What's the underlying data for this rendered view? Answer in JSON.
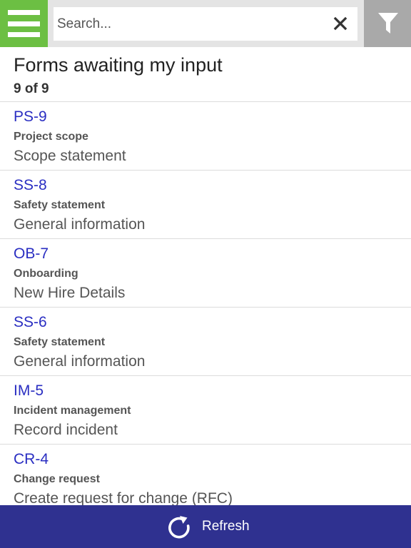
{
  "search": {
    "placeholder": "Search..."
  },
  "icons": {
    "menu": "hamburger-menu-icon",
    "clear": "close-icon",
    "filter": "filter-icon",
    "refresh": "refresh-icon"
  },
  "colors": {
    "menu_bg": "#6cbf43",
    "filter_bg": "#a9a9a9",
    "link": "#2a2ec2",
    "footer_bg": "#2f3190"
  },
  "header": {
    "title": "Forms awaiting my input",
    "count": "9 of 9"
  },
  "forms": [
    {
      "id": "PS-9",
      "category": "Project scope",
      "title": "Scope statement"
    },
    {
      "id": "SS-8",
      "category": "Safety statement",
      "title": "General information"
    },
    {
      "id": "OB-7",
      "category": "Onboarding",
      "title": "New Hire Details"
    },
    {
      "id": "SS-6",
      "category": "Safety statement",
      "title": "General information"
    },
    {
      "id": "IM-5",
      "category": "Incident management",
      "title": "Record incident"
    },
    {
      "id": "CR-4",
      "category": "Change request",
      "title": "Create request for change (RFC)"
    }
  ],
  "footer": {
    "refresh_label": "Refresh"
  }
}
